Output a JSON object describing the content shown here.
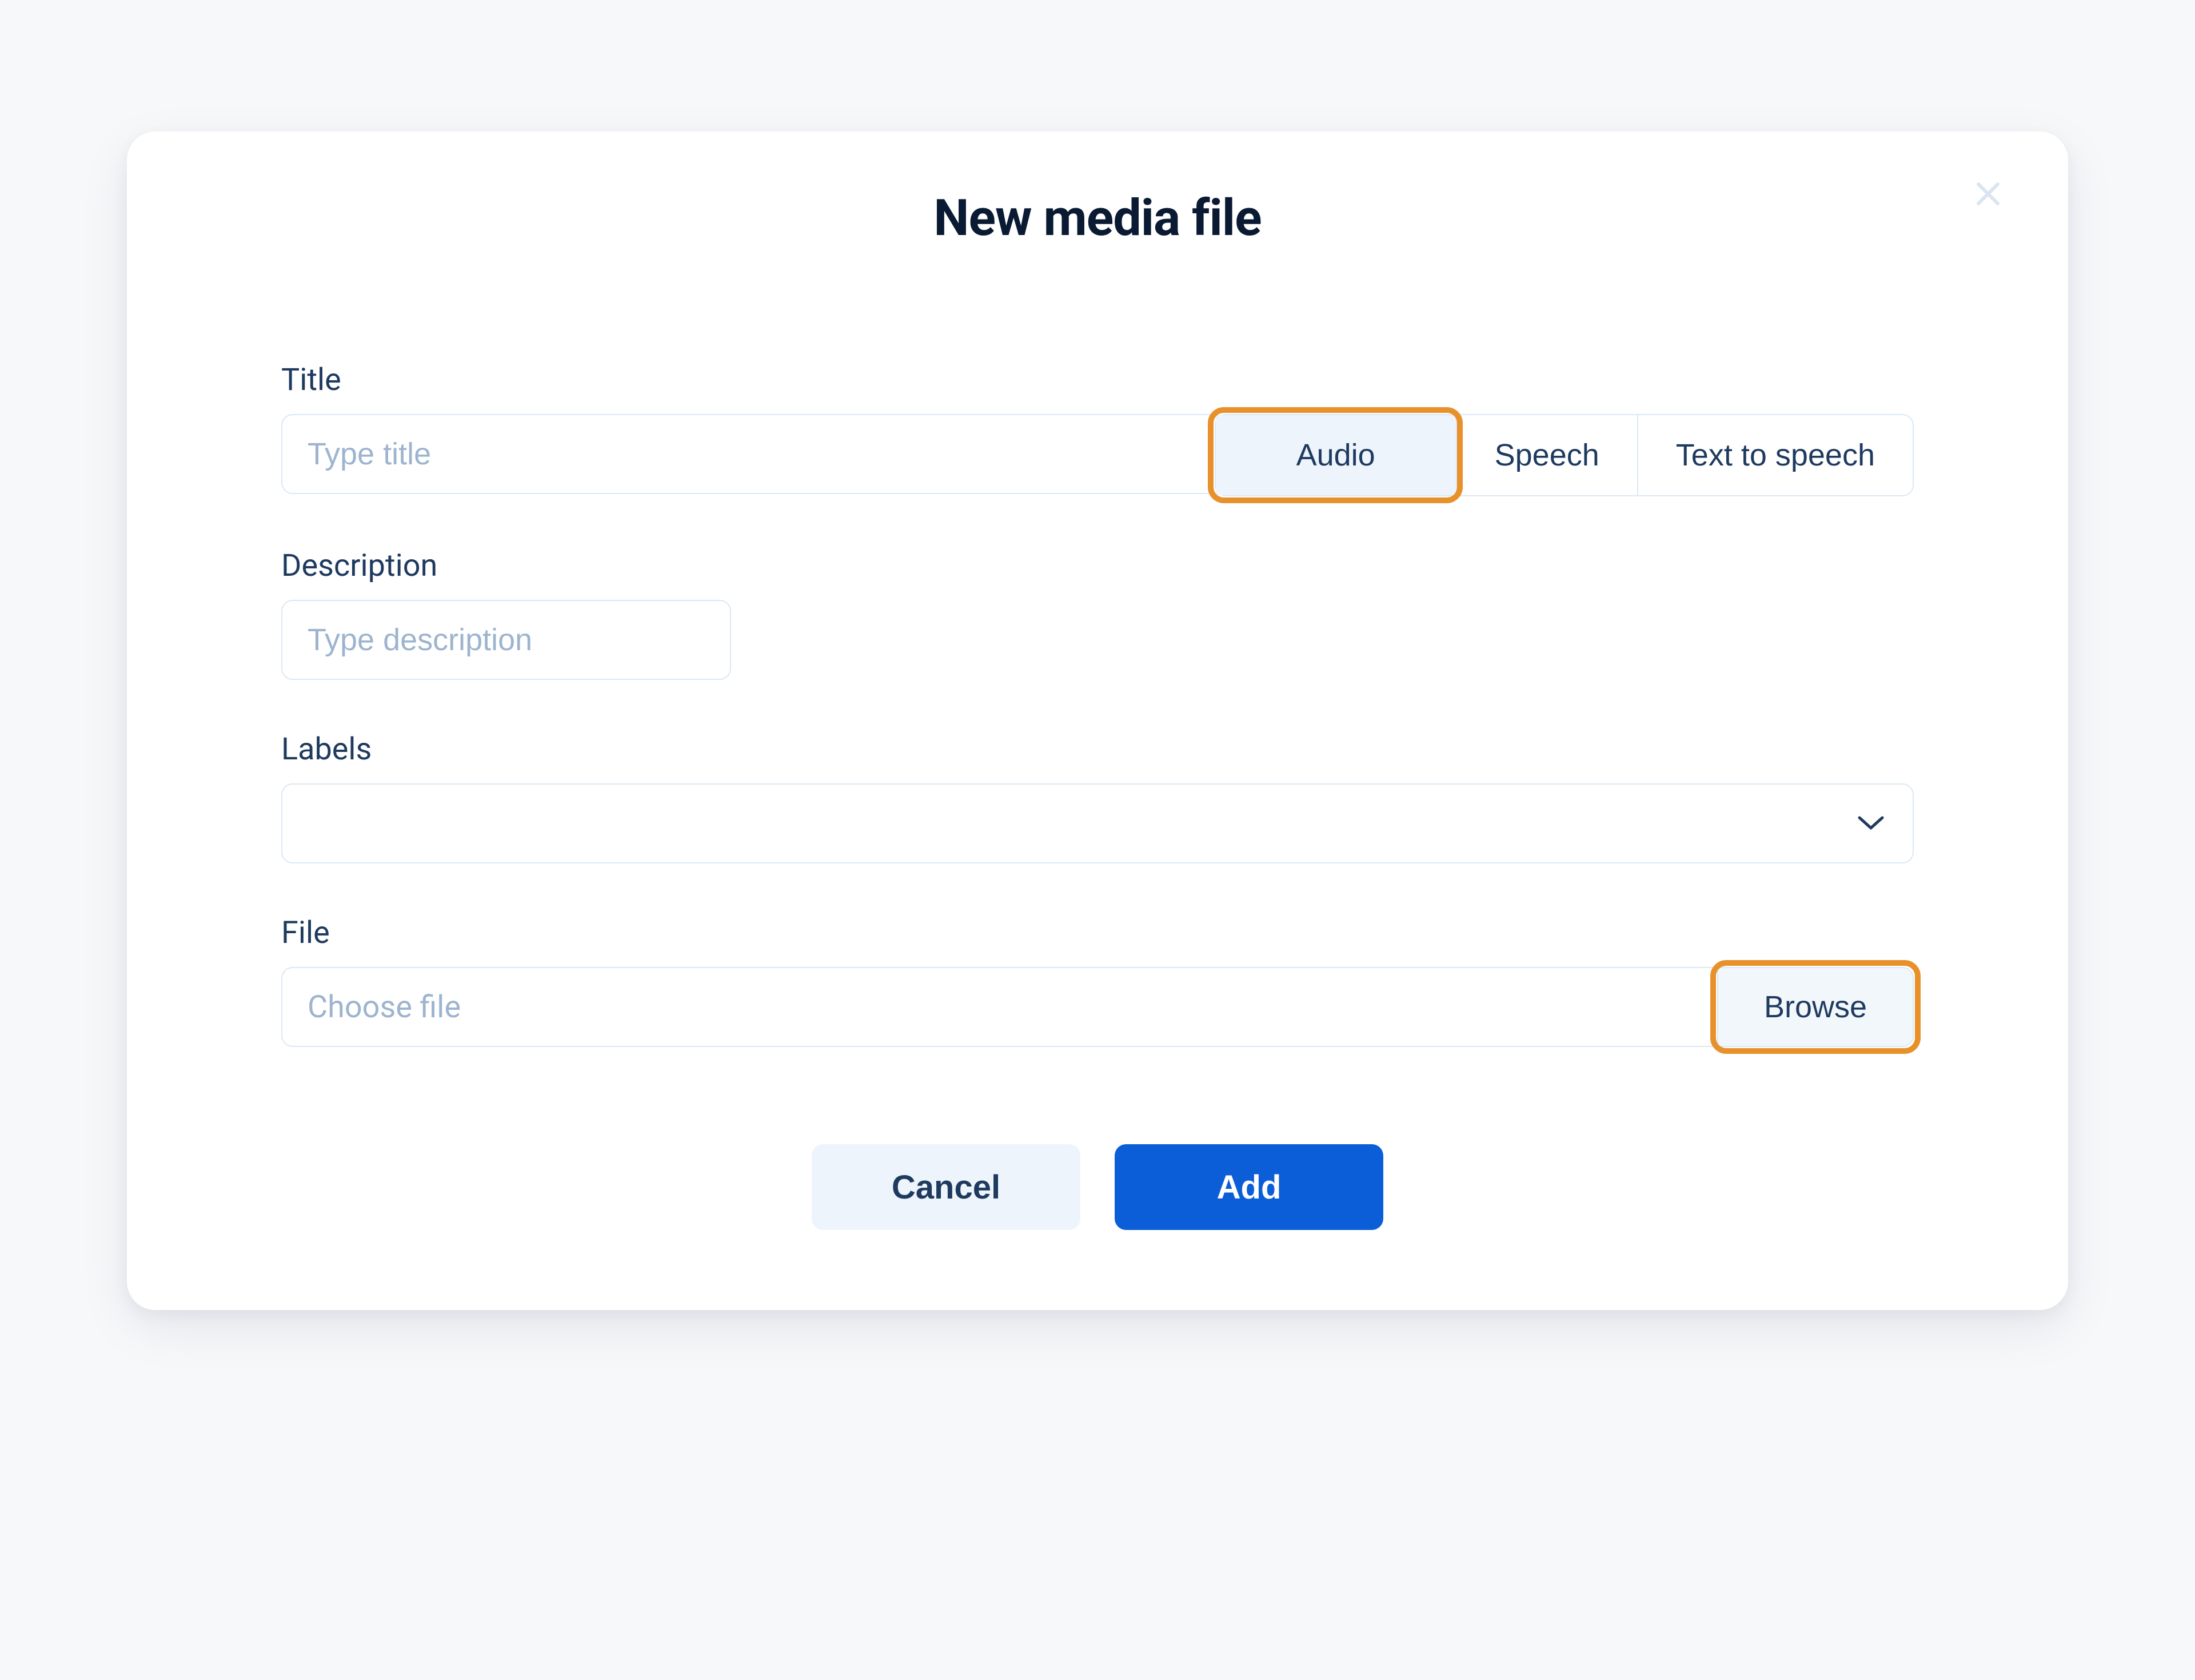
{
  "modal": {
    "title": "New media file",
    "fields": {
      "title": {
        "label": "Title",
        "placeholder": "Type title",
        "value": ""
      },
      "type": {
        "options": [
          "Audio",
          "Speech",
          "Text to speech"
        ],
        "selected": "Audio"
      },
      "description": {
        "label": "Description",
        "placeholder": "Type description",
        "value": ""
      },
      "labels": {
        "label": "Labels",
        "value": ""
      },
      "file": {
        "label": "File",
        "placeholder": "Choose file",
        "browse_label": "Browse"
      }
    },
    "actions": {
      "cancel": "Cancel",
      "add": "Add"
    }
  },
  "highlights": {
    "audio_button": true,
    "browse_button": true
  },
  "colors": {
    "highlight": "#e8912b",
    "primary": "#0b5ed7",
    "text_dark": "#0a1a33",
    "text_body": "#1e3a5f",
    "placeholder": "#9db4cf",
    "border": "#dbe8f4",
    "light_bg": "#edf4fb"
  }
}
